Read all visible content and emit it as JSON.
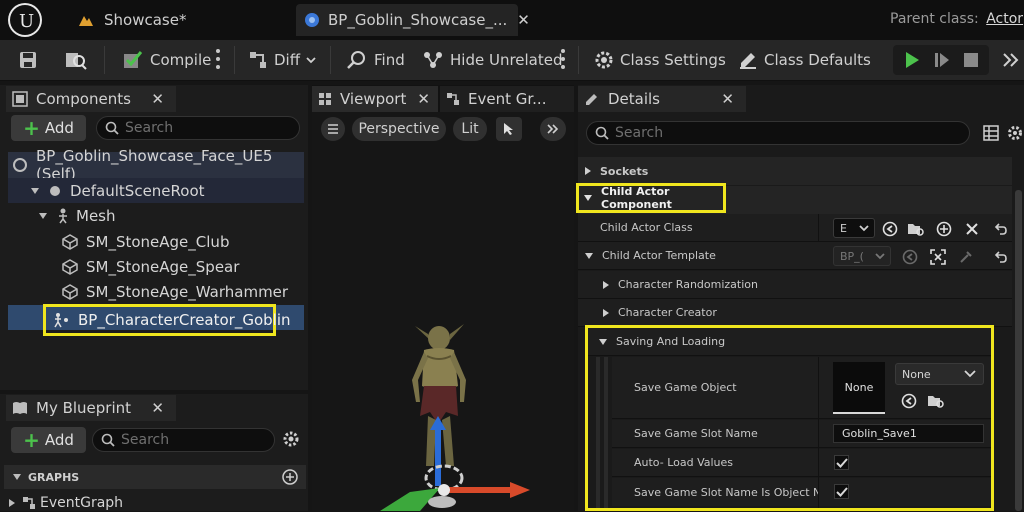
{
  "titlebar": {
    "tab1": "Showcase*",
    "tab2": "BP_Goblin_Showcase_...",
    "parent_class_label": "Parent class:",
    "parent_class_value": "Actor"
  },
  "toolbar": {
    "compile": "Compile",
    "diff": "Diff",
    "find": "Find",
    "hide_unrelated": "Hide Unrelated",
    "class_settings": "Class Settings",
    "class_defaults": "Class Defaults"
  },
  "components": {
    "title": "Components",
    "add": "Add",
    "search_placeholder": "Search",
    "items": [
      "BP_Goblin_Showcase_Face_UE5 (Self)",
      "DefaultSceneRoot",
      "Mesh",
      "SM_StoneAge_Club",
      "SM_StoneAge_Spear",
      "SM_StoneAge_Warhammer",
      "BP_CharacterCreator_Goblin"
    ]
  },
  "my_blueprint": {
    "title": "My Blueprint",
    "add": "Add",
    "search_placeholder": "Search",
    "graphs_label": "GRAPHS",
    "event_graph": "EventGraph"
  },
  "viewport": {
    "tab_viewport": "Viewport",
    "tab_event_graph": "Event Gr...",
    "perspective": "Perspective",
    "lit": "Lit"
  },
  "details": {
    "title": "Details",
    "search_placeholder": "Search",
    "sockets": "Sockets",
    "child_actor_component": "Child Actor Component",
    "child_actor_class": "Child Actor Class",
    "child_actor_class_value": "E",
    "child_actor_template": "Child Actor Template",
    "child_actor_template_value": "BP_(",
    "character_randomization": "Character Randomization",
    "character_creator": "Character Creator",
    "saving_and_loading": "Saving And Loading",
    "save_game_object": "Save Game Object",
    "thumb_none": "None",
    "combo_none": "None",
    "save_game_slot_name": "Save Game Slot Name",
    "slot_value": "Goblin_Save1",
    "auto_load_values": "Auto- Load Values",
    "slot_is_object_name": "Save Game Slot Name Is Object Na..."
  },
  "colors": {
    "highlight": "#f0e61e",
    "selection": "#2f4a6e",
    "play_green": "#4cc24c"
  }
}
